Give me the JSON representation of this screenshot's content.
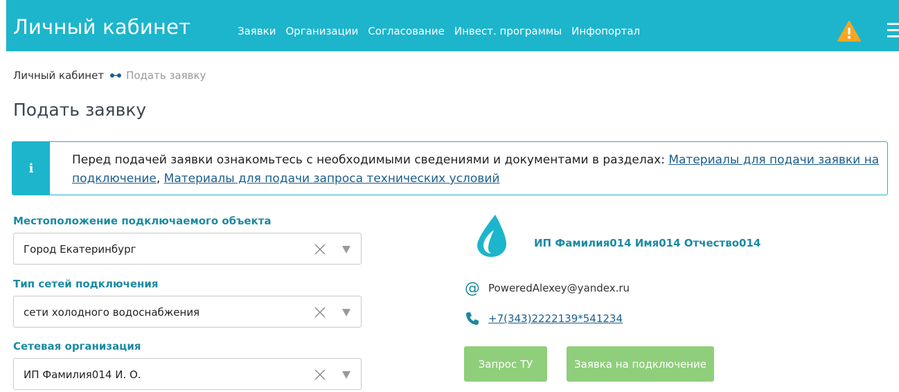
{
  "header": {
    "brand": "Личный кабинет",
    "nav": [
      "Заявки",
      "Организации",
      "Согласование",
      "Инвест. программы",
      "Инфопортал"
    ]
  },
  "breadcrumb": {
    "home": "Личный кабинет",
    "current": "Подать заявку"
  },
  "page": {
    "title": "Подать заявку"
  },
  "alert": {
    "icon": "i",
    "text_prefix": "Перед подачей заявки ознакомьтесь с необходимыми сведениями и документами в разделах: ",
    "link1": "Материалы для подачи заявки на подключение",
    "separator": ", ",
    "link2": "Материалы для подачи запроса технических условий"
  },
  "form": {
    "location_label": "Местоположение подключаемого объекта",
    "location_value": "Город Екатеринбург",
    "network_type_label": "Тип сетей подключения",
    "network_type_value": "сети холодного водоснабжения",
    "org_label": "Сетевая организация",
    "org_value": "ИП Фамилия014 И. О."
  },
  "org_card": {
    "name": "ИП Фамилия014 Имя014 Отчество014",
    "email": "PoweredAlexey@yandex.ru",
    "phone": "+7(343)2222139*541234",
    "button_tu": "Запрос ТУ",
    "button_connect": "Заявка на подключение"
  },
  "colors": {
    "primary": "#1cb5cc",
    "label": "#1b8aa3",
    "button": "#8fce7a",
    "warning": "#f5a623"
  },
  "icons": [
    "warning-icon",
    "menu-icon",
    "info-icon",
    "clear-icon",
    "dropdown-arrow-icon",
    "water-drop-icon",
    "at-icon",
    "phone-icon"
  ]
}
